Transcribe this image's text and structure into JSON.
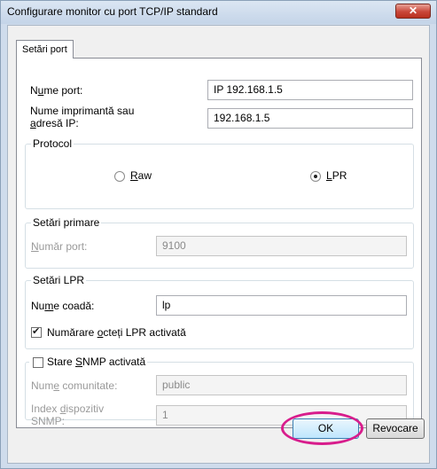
{
  "window": {
    "title": "Configurare monitor cu port TCP/IP standard",
    "close_glyph": "✕"
  },
  "tabs": [
    {
      "label": "Setări port"
    }
  ],
  "fields": {
    "port_name": {
      "label_pre": "N",
      "label_u": "u",
      "label_post": "me port:",
      "value": "IP 192.168.1.5"
    },
    "printer_ip": {
      "label_line1": "Nume imprimantă sau",
      "label_line2_u": "a",
      "label_line2_post": "dresă IP:",
      "value": "192.168.1.5"
    }
  },
  "protocol": {
    "legend": "Protocol",
    "raw": {
      "label_u": "R",
      "label_post": "aw",
      "selected": false
    },
    "lpr": {
      "label_u": "L",
      "label_post": "PR",
      "selected": true
    }
  },
  "raw_settings": {
    "legend": "Setări primare",
    "port_number": {
      "label_u": "N",
      "label_post": "umăr port:",
      "value": "9100"
    }
  },
  "lpr_settings": {
    "legend": "Setări LPR",
    "queue_name": {
      "label_pre": "Nu",
      "label_u": "m",
      "label_post": "e coadă:",
      "value": "lp"
    },
    "byte_count": {
      "label_pre": "Numărare ",
      "label_u": "o",
      "label_post": "cteți LPR activată",
      "checked": true
    }
  },
  "snmp": {
    "legend_pre": "Stare ",
    "legend_u": "S",
    "legend_post": "NMP activată",
    "checked": false,
    "community": {
      "label_pre": "Num",
      "label_u": "e",
      "label_post": " comunitate:",
      "value": "public"
    },
    "device_index": {
      "label_line1": "Index ",
      "label_line1_u": "d",
      "label_line1_post": "ispozitiv",
      "label_line2": "SNMP:",
      "value": "1"
    }
  },
  "buttons": {
    "ok": "OK",
    "cancel": "Revocare"
  },
  "colors": {
    "highlight": "#d81d8c",
    "titlebar": "#c4d4e8",
    "close": "#c9473a"
  }
}
